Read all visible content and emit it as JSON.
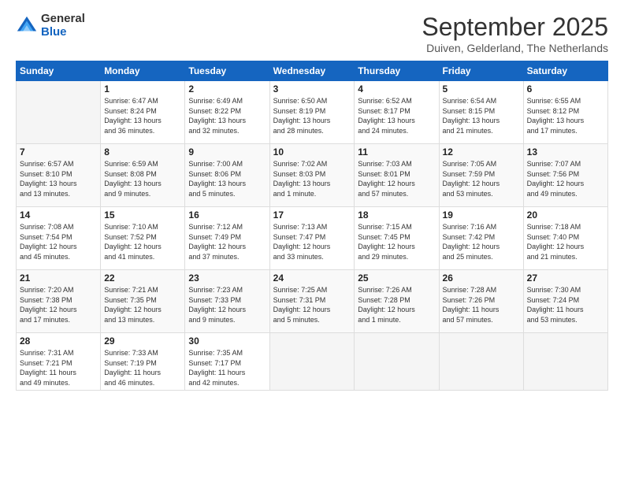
{
  "logo": {
    "general": "General",
    "blue": "Blue"
  },
  "header": {
    "month": "September 2025",
    "location": "Duiven, Gelderland, The Netherlands"
  },
  "days_of_week": [
    "Sunday",
    "Monday",
    "Tuesday",
    "Wednesday",
    "Thursday",
    "Friday",
    "Saturday"
  ],
  "weeks": [
    [
      {
        "day": "",
        "info": ""
      },
      {
        "day": "1",
        "info": "Sunrise: 6:47 AM\nSunset: 8:24 PM\nDaylight: 13 hours\nand 36 minutes."
      },
      {
        "day": "2",
        "info": "Sunrise: 6:49 AM\nSunset: 8:22 PM\nDaylight: 13 hours\nand 32 minutes."
      },
      {
        "day": "3",
        "info": "Sunrise: 6:50 AM\nSunset: 8:19 PM\nDaylight: 13 hours\nand 28 minutes."
      },
      {
        "day": "4",
        "info": "Sunrise: 6:52 AM\nSunset: 8:17 PM\nDaylight: 13 hours\nand 24 minutes."
      },
      {
        "day": "5",
        "info": "Sunrise: 6:54 AM\nSunset: 8:15 PM\nDaylight: 13 hours\nand 21 minutes."
      },
      {
        "day": "6",
        "info": "Sunrise: 6:55 AM\nSunset: 8:12 PM\nDaylight: 13 hours\nand 17 minutes."
      }
    ],
    [
      {
        "day": "7",
        "info": "Sunrise: 6:57 AM\nSunset: 8:10 PM\nDaylight: 13 hours\nand 13 minutes."
      },
      {
        "day": "8",
        "info": "Sunrise: 6:59 AM\nSunset: 8:08 PM\nDaylight: 13 hours\nand 9 minutes."
      },
      {
        "day": "9",
        "info": "Sunrise: 7:00 AM\nSunset: 8:06 PM\nDaylight: 13 hours\nand 5 minutes."
      },
      {
        "day": "10",
        "info": "Sunrise: 7:02 AM\nSunset: 8:03 PM\nDaylight: 13 hours\nand 1 minute."
      },
      {
        "day": "11",
        "info": "Sunrise: 7:03 AM\nSunset: 8:01 PM\nDaylight: 12 hours\nand 57 minutes."
      },
      {
        "day": "12",
        "info": "Sunrise: 7:05 AM\nSunset: 7:59 PM\nDaylight: 12 hours\nand 53 minutes."
      },
      {
        "day": "13",
        "info": "Sunrise: 7:07 AM\nSunset: 7:56 PM\nDaylight: 12 hours\nand 49 minutes."
      }
    ],
    [
      {
        "day": "14",
        "info": "Sunrise: 7:08 AM\nSunset: 7:54 PM\nDaylight: 12 hours\nand 45 minutes."
      },
      {
        "day": "15",
        "info": "Sunrise: 7:10 AM\nSunset: 7:52 PM\nDaylight: 12 hours\nand 41 minutes."
      },
      {
        "day": "16",
        "info": "Sunrise: 7:12 AM\nSunset: 7:49 PM\nDaylight: 12 hours\nand 37 minutes."
      },
      {
        "day": "17",
        "info": "Sunrise: 7:13 AM\nSunset: 7:47 PM\nDaylight: 12 hours\nand 33 minutes."
      },
      {
        "day": "18",
        "info": "Sunrise: 7:15 AM\nSunset: 7:45 PM\nDaylight: 12 hours\nand 29 minutes."
      },
      {
        "day": "19",
        "info": "Sunrise: 7:16 AM\nSunset: 7:42 PM\nDaylight: 12 hours\nand 25 minutes."
      },
      {
        "day": "20",
        "info": "Sunrise: 7:18 AM\nSunset: 7:40 PM\nDaylight: 12 hours\nand 21 minutes."
      }
    ],
    [
      {
        "day": "21",
        "info": "Sunrise: 7:20 AM\nSunset: 7:38 PM\nDaylight: 12 hours\nand 17 minutes."
      },
      {
        "day": "22",
        "info": "Sunrise: 7:21 AM\nSunset: 7:35 PM\nDaylight: 12 hours\nand 13 minutes."
      },
      {
        "day": "23",
        "info": "Sunrise: 7:23 AM\nSunset: 7:33 PM\nDaylight: 12 hours\nand 9 minutes."
      },
      {
        "day": "24",
        "info": "Sunrise: 7:25 AM\nSunset: 7:31 PM\nDaylight: 12 hours\nand 5 minutes."
      },
      {
        "day": "25",
        "info": "Sunrise: 7:26 AM\nSunset: 7:28 PM\nDaylight: 12 hours\nand 1 minute."
      },
      {
        "day": "26",
        "info": "Sunrise: 7:28 AM\nSunset: 7:26 PM\nDaylight: 11 hours\nand 57 minutes."
      },
      {
        "day": "27",
        "info": "Sunrise: 7:30 AM\nSunset: 7:24 PM\nDaylight: 11 hours\nand 53 minutes."
      }
    ],
    [
      {
        "day": "28",
        "info": "Sunrise: 7:31 AM\nSunset: 7:21 PM\nDaylight: 11 hours\nand 49 minutes."
      },
      {
        "day": "29",
        "info": "Sunrise: 7:33 AM\nSunset: 7:19 PM\nDaylight: 11 hours\nand 46 minutes."
      },
      {
        "day": "30",
        "info": "Sunrise: 7:35 AM\nSunset: 7:17 PM\nDaylight: 11 hours\nand 42 minutes."
      },
      {
        "day": "",
        "info": ""
      },
      {
        "day": "",
        "info": ""
      },
      {
        "day": "",
        "info": ""
      },
      {
        "day": "",
        "info": ""
      }
    ]
  ]
}
